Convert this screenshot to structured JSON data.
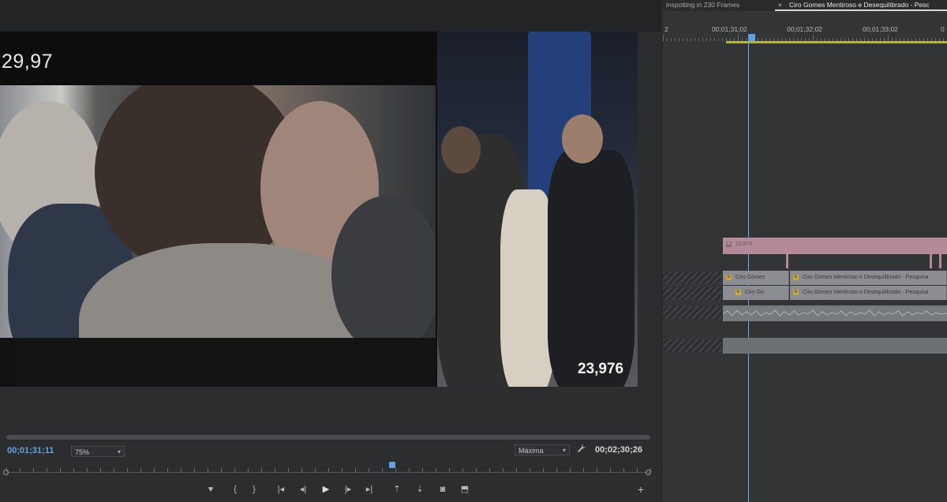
{
  "program_monitor": {
    "left_clip_fps": "29,97",
    "right_clip_fps": "23,976",
    "current_timecode": "00;01;31;11",
    "zoom_level": "75%",
    "playback_quality": "Máxima",
    "duration_timecode": "00;02;30;26",
    "playhead_position": 0.6
  },
  "transport_buttons": [
    {
      "icon": "marker-icon",
      "glyph": "♥"
    },
    {
      "icon": "mark-in-icon",
      "glyph": "{"
    },
    {
      "icon": "mark-out-icon",
      "glyph": "}"
    },
    {
      "icon": "go-to-in-icon",
      "glyph": "|◂"
    },
    {
      "icon": "step-back-icon",
      "glyph": "◂|"
    },
    {
      "icon": "play-icon",
      "glyph": "▶"
    },
    {
      "icon": "step-forward-icon",
      "glyph": "|▸"
    },
    {
      "icon": "go-to-out-icon",
      "glyph": "▸|"
    },
    {
      "icon": "lift-icon",
      "glyph": "⇡"
    },
    {
      "icon": "extract-icon",
      "glyph": "⇣"
    },
    {
      "icon": "export-frame-icon",
      "glyph": "◙"
    },
    {
      "icon": "comparison-view-icon",
      "glyph": "⬒"
    },
    {
      "icon": "add-button-icon",
      "glyph": "+"
    }
  ],
  "timeline": {
    "tabs": [
      {
        "label": "inspotting in 230 Frames"
      },
      {
        "label": "Ciro Gomes Mentiroso e Desequilibrado - Pesc",
        "close": "×"
      }
    ],
    "ruler_labels": [
      "2",
      "00;01;31;02",
      "00;01;32;02",
      "00;01;33;02",
      "0"
    ],
    "pink_clip_label": "23,976",
    "video_clips": [
      {
        "label_a": "Ciro Gomes",
        "label_b": "Ciro Gomes Mentiroso e Desequilibrado - Pesquisa"
      },
      {
        "label_a": "Ciro Go",
        "label_b": "Ciro Gomes Mentiroso e Desequilibrado - Pesquisa"
      }
    ]
  },
  "colors": {
    "accent_blue": "#5fa4e0",
    "workarea_yellow": "#b5b33a",
    "pink_clip": "#b48a9b"
  }
}
